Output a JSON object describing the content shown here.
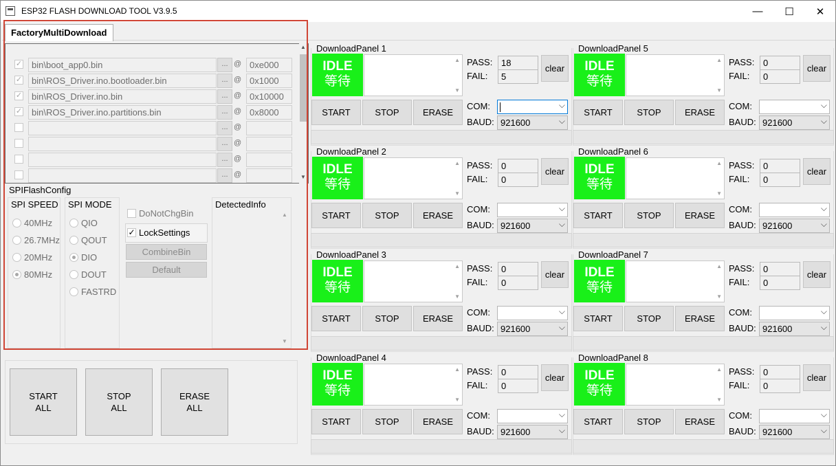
{
  "window": {
    "title": "ESP32 FLASH DOWNLOAD TOOL V3.9.5",
    "minimize": "—",
    "maximize": "☐",
    "close": "✕"
  },
  "tab": {
    "label": "FactoryMultiDownload"
  },
  "files": [
    {
      "checked": true,
      "path": "bin\\boot_app0.bin",
      "browse": "...",
      "at": "@",
      "addr": "0xe000"
    },
    {
      "checked": true,
      "path": "bin\\ROS_Driver.ino.bootloader.bin",
      "browse": "...",
      "at": "@",
      "addr": "0x1000"
    },
    {
      "checked": true,
      "path": "bin\\ROS_Driver.ino.bin",
      "browse": "...",
      "at": "@",
      "addr": "0x10000"
    },
    {
      "checked": true,
      "path": "bin\\ROS_Driver.ino.partitions.bin",
      "browse": "...",
      "at": "@",
      "addr": "0x8000"
    },
    {
      "checked": false,
      "path": "",
      "browse": "...",
      "at": "@",
      "addr": ""
    },
    {
      "checked": false,
      "path": "",
      "browse": "...",
      "at": "@",
      "addr": ""
    },
    {
      "checked": false,
      "path": "",
      "browse": "...",
      "at": "@",
      "addr": ""
    },
    {
      "checked": false,
      "path": "",
      "browse": "...",
      "at": "@",
      "addr": ""
    }
  ],
  "spi": {
    "legend": "SPIFlashConfig",
    "speed_title": "SPI SPEED",
    "speeds": [
      "40MHz",
      "26.7MHz",
      "20MHz",
      "80MHz"
    ],
    "speed_selected": 3,
    "mode_title": "SPI MODE",
    "modes": [
      "QIO",
      "QOUT",
      "DIO",
      "DOUT",
      "FASTRD"
    ],
    "mode_selected": 2,
    "donotchgbin": "DoNotChgBin",
    "locksettings": "LockSettings",
    "combinebin": "CombineBin",
    "default": "Default",
    "detected_title": "DetectedInfo"
  },
  "all_buttons": {
    "start": [
      "START",
      "ALL"
    ],
    "stop": [
      "STOP",
      "ALL"
    ],
    "erase": [
      "ERASE",
      "ALL"
    ]
  },
  "panel_labels": {
    "idle": "IDLE",
    "idle_zh": "等待",
    "pass": "PASS:",
    "fail": "FAIL:",
    "clear": "clear",
    "start": "START",
    "stop": "STOP",
    "erase": "ERASE",
    "com": "COM:",
    "baud": "BAUD:"
  },
  "panels": [
    {
      "title": "DownloadPanel 1",
      "pass": "18",
      "fail": "5",
      "com": "",
      "baud": "921600",
      "com_active": true
    },
    {
      "title": "DownloadPanel 2",
      "pass": "0",
      "fail": "0",
      "com": "",
      "baud": "921600"
    },
    {
      "title": "DownloadPanel 3",
      "pass": "0",
      "fail": "0",
      "com": "",
      "baud": "921600"
    },
    {
      "title": "DownloadPanel 4",
      "pass": "0",
      "fail": "0",
      "com": "",
      "baud": "921600"
    },
    {
      "title": "DownloadPanel 5",
      "pass": "0",
      "fail": "0",
      "com": "",
      "baud": "921600"
    },
    {
      "title": "DownloadPanel 6",
      "pass": "0",
      "fail": "0",
      "com": "",
      "baud": "921600"
    },
    {
      "title": "DownloadPanel 7",
      "pass": "0",
      "fail": "0",
      "com": "",
      "baud": "921600"
    },
    {
      "title": "DownloadPanel 8",
      "pass": "0",
      "fail": "0",
      "com": "",
      "baud": "921600"
    }
  ],
  "colors": {
    "idle_green": "#19f019",
    "highlight_red": "#d04535"
  }
}
